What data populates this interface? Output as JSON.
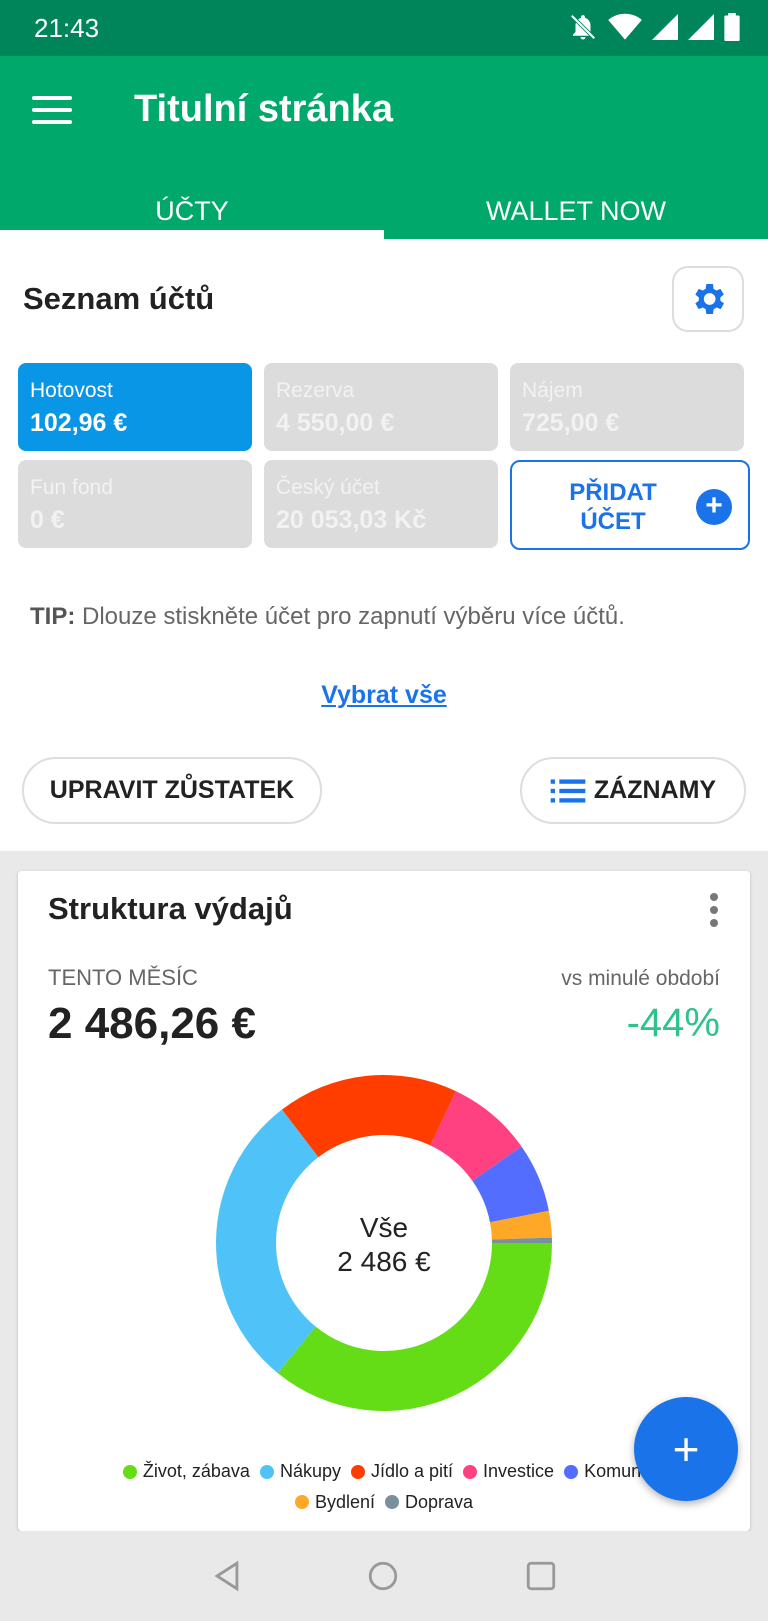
{
  "status": {
    "time": "21:43"
  },
  "appbar": {
    "title": "Titulní stránka"
  },
  "tabs": [
    {
      "label": "ÚČTY",
      "active": true
    },
    {
      "label": "WALLET NOW",
      "active": false
    }
  ],
  "accounts": {
    "title": "Seznam účtů",
    "items": [
      {
        "name": "Hotovost",
        "balance": "102,96 €",
        "active": true
      },
      {
        "name": "Rezerva",
        "balance": "4 550,00 €",
        "active": false
      },
      {
        "name": "Nájem",
        "balance": "725,00 €",
        "active": false
      },
      {
        "name": "Fun fond",
        "balance": "0 €",
        "active": false
      },
      {
        "name": "Český účet",
        "balance": "20 053,03 Kč",
        "active": false
      }
    ],
    "add_label": "PŘIDAT ÚČET",
    "tip_prefix": "TIP:",
    "tip_text": " Dlouze stiskněte účet pro zapnutí výběru více účtů.",
    "select_all": "Vybrat vše",
    "adjust_balance": "UPRAVIT ZŮSTATEK",
    "records": "ZÁZNAMY"
  },
  "expenses": {
    "title": "Struktura výdajů",
    "period_label": "TENTO MĚSÍC",
    "total": "2 486,26 €",
    "vs_label": "vs minulé období",
    "vs_value": "-44%",
    "center_label": "Vše",
    "center_value": "2 486 €"
  },
  "chart_data": {
    "type": "pie",
    "categories": [
      "Život, zábava",
      "Nákupy",
      "Jídlo a pití",
      "Investice",
      "Komunikace",
      "Bydlení",
      "Doprava"
    ],
    "legend_labels": [
      "Život, zábava",
      "Nákupy",
      "Jídlo a pití",
      "Investice",
      "Komuni",
      "Bydlení",
      "Doprava"
    ],
    "values": [
      35.0,
      28.0,
      17.0,
      8.0,
      6.5,
      2.5,
      0.5
    ],
    "colors": [
      "#64dd17",
      "#4fc3f7",
      "#ff3d00",
      "#ff4081",
      "#536dfe",
      "#ffa726",
      "#78909c"
    ]
  },
  "colors": {
    "primary": "#00a86b",
    "accent": "#1a73e8",
    "active_account": "#0a96e6",
    "positive": "#2ec38a"
  }
}
